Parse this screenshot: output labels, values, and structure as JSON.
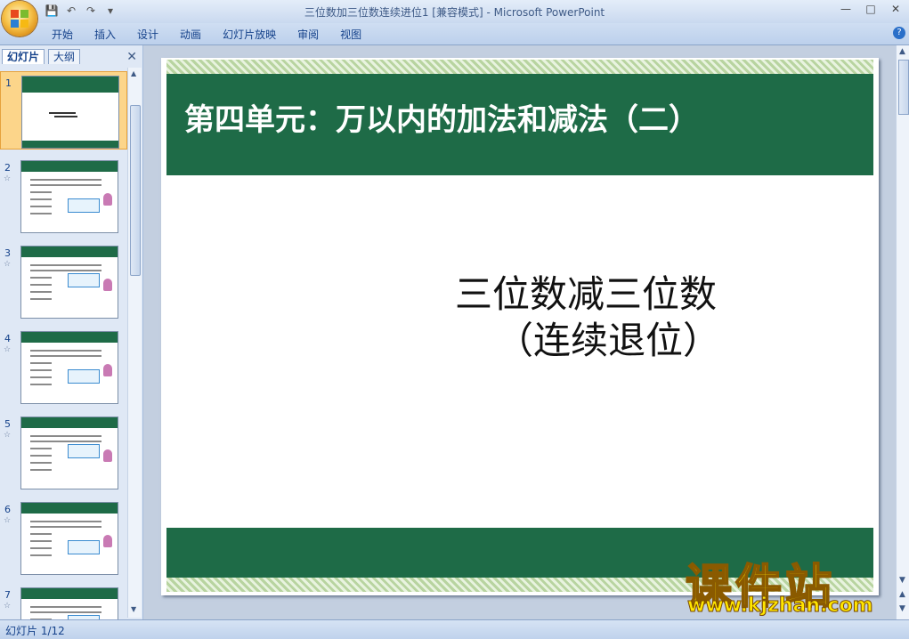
{
  "window": {
    "title": "三位数加三位数连续进位1 [兼容模式]",
    "separator": " - ",
    "app": "Microsoft PowerPoint"
  },
  "ribbon": {
    "tabs": [
      "开始",
      "插入",
      "设计",
      "动画",
      "幻灯片放映",
      "审阅",
      "视图"
    ]
  },
  "panel": {
    "tab_slides": "幻灯片",
    "tab_outline": "大纲",
    "thumbnails": [
      {
        "num": "1",
        "selected": true
      },
      {
        "num": "2",
        "selected": false
      },
      {
        "num": "3",
        "selected": false
      },
      {
        "num": "4",
        "selected": false
      },
      {
        "num": "5",
        "selected": false
      },
      {
        "num": "6",
        "selected": false
      },
      {
        "num": "7",
        "selected": false
      }
    ]
  },
  "slide": {
    "title": "第四单元：万以内的加法和减法（二）",
    "subtitle_line1": "三位数减三位数",
    "subtitle_line2": "（连续退位）"
  },
  "watermark": {
    "brand": "课件站",
    "url": "www.kjzhan.com"
  },
  "status": {
    "slide_counter": "幻灯片 1/12"
  },
  "colors": {
    "slide_green": "#1e6b47",
    "watermark_yellow": "#ffe600"
  }
}
